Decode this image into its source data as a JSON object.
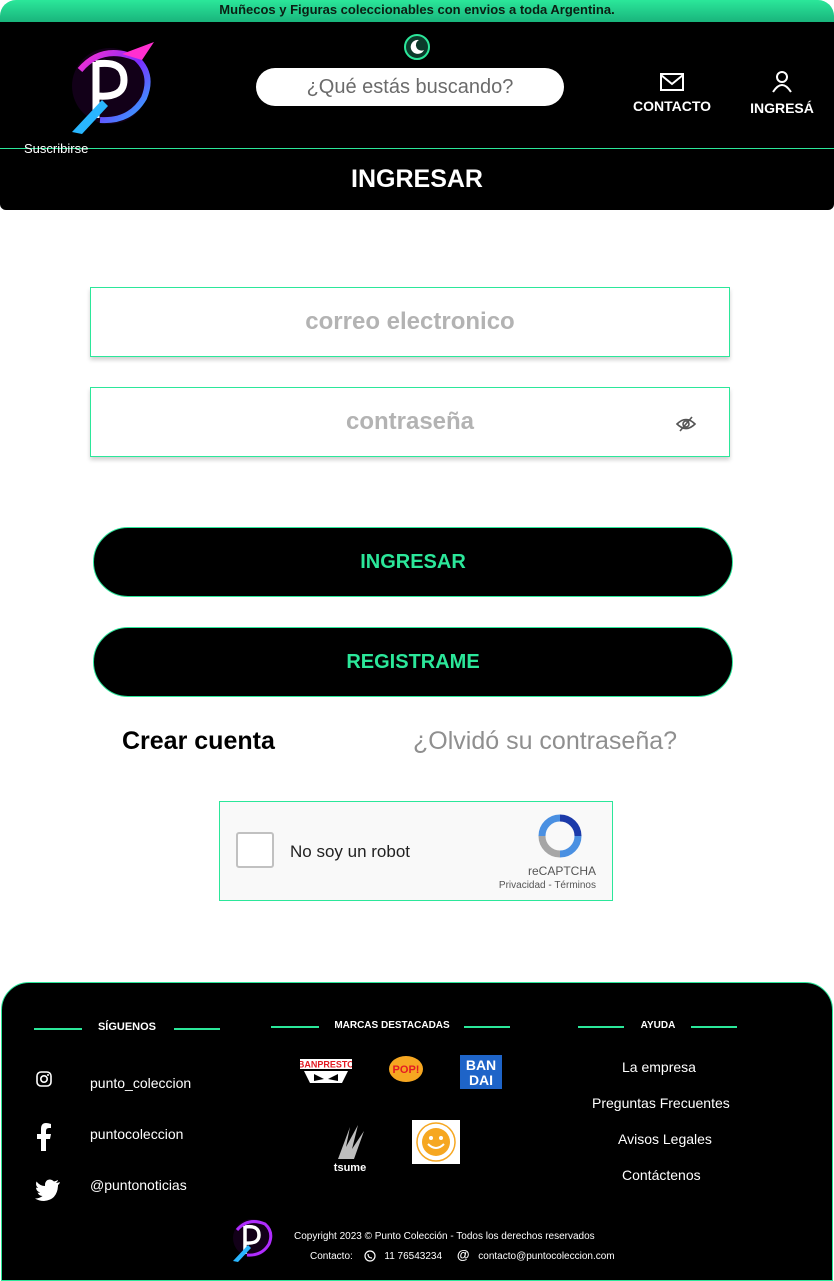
{
  "topbar": {
    "announcement": "Muñecos y Figuras coleccionables con envios a toda Argentina."
  },
  "header": {
    "search_placeholder": "¿Qué estás buscando?",
    "contact_label": "CONTACTO",
    "login_label": "INGRESÁ",
    "subscribe_label": "Suscribirse",
    "page_title": "INGRESAR"
  },
  "form": {
    "email_placeholder": "correo electronico",
    "password_placeholder": "contraseña",
    "login_button": "INGRESAR",
    "register_button": "REGISTRAME",
    "create_account": "Crear cuenta",
    "forgot_password": "¿Olvidó su contraseña?"
  },
  "captcha": {
    "label": "No soy un robot",
    "brand": "reCAPTCHA",
    "links": "Privacidad - Términos"
  },
  "footer": {
    "follow_title": "SÍGUENOS",
    "brands_title": "MARCAS DESTACADAS",
    "help_title": "AYUDA",
    "social": {
      "instagram": "punto_coleccion",
      "facebook": "puntocoleccion",
      "twitter": "@puntonoticias"
    },
    "brands": {
      "banpresto": "BANPRESTO",
      "pop": "POP!",
      "bandai_line1": "BAN",
      "bandai_line2": "DAI",
      "tsume": "tsume"
    },
    "help_links": [
      "La empresa",
      "Preguntas  Frecuentes",
      "Avisos Legales",
      "Contáctenos"
    ],
    "copyright": "Copyright 2023 © Punto Colección - Todos los derechos reservados",
    "contact_label": "Contacto:",
    "phone": "11 76543234",
    "email": "contacto@puntocoleccion.com"
  },
  "colors": {
    "accent": "#2be79a",
    "background_dark": "#000000"
  }
}
